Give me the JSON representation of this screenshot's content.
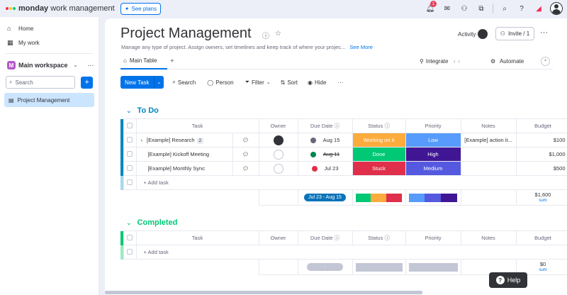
{
  "topbar": {
    "brand": "monday",
    "brand_sub": "work management",
    "see_plans": "See plans",
    "notif_count": "1",
    "logo_colors": [
      "#f62b54",
      "#ffcb00",
      "#00ca72"
    ]
  },
  "sidebar": {
    "items": [
      {
        "label": "Home",
        "icon": "home-icon"
      },
      {
        "label": "My work",
        "icon": "calendar-icon"
      }
    ],
    "workspace": {
      "badge": "M",
      "name": "Main workspace"
    },
    "search_placeholder": "Search",
    "boards": [
      {
        "label": "Project Management",
        "icon": "board-icon"
      }
    ]
  },
  "board": {
    "title": "Project Management",
    "description": "Manage any type of project. Assign owners, set timelines and keep track of where your projec...",
    "see_more": "See More",
    "activity": "Activity",
    "invite": "Invite / 1",
    "tab_main": "Main Table",
    "integrate": "Integrate",
    "automate": "Automate"
  },
  "toolbar": {
    "new_task": "New Task",
    "search": "Search",
    "person": "Person",
    "filter": "Filter",
    "sort": "Sort",
    "hide": "Hide"
  },
  "columns": {
    "task": "Task",
    "owner": "Owner",
    "due_date": "Due Date",
    "status": "Status",
    "priority": "Priority",
    "notes": "Notes",
    "budget": "Budget"
  },
  "groups": [
    {
      "name": "To Do",
      "color": "#0086c0",
      "rows": [
        {
          "task": "[Example] Research",
          "subitems": "2",
          "due": "Aug 15",
          "status": "Working on it",
          "status_color": "#fdab3d",
          "priority": "Low",
          "priority_color": "#579bfc",
          "notes": "[Example] action it...",
          "budget": "$100"
        },
        {
          "task": "[Example] Kickoff Meeting",
          "subitems": "",
          "due": "Aug 11",
          "status": "Done",
          "status_color": "#00c875",
          "priority": "High",
          "priority_color": "#401694",
          "notes": "",
          "budget": "$1,000"
        },
        {
          "task": "[Example] Monthly Sync",
          "subitems": "",
          "due": "Jul 23",
          "status": "Stuck",
          "status_color": "#df2f4a",
          "priority": "Medium",
          "priority_color": "#5559df",
          "notes": "",
          "budget": "$500"
        }
      ],
      "add_task": "+ Add task",
      "timeline": "Jul 23 - Aug 15",
      "status_summary": [
        {
          "color": "#00c875",
          "fraction": 0.333
        },
        {
          "color": "#fdab3d",
          "fraction": 0.333
        },
        {
          "color": "#df2f4a",
          "fraction": 0.334
        }
      ],
      "priority_summary": [
        {
          "color": "#579bfc",
          "fraction": 0.333
        },
        {
          "color": "#5559df",
          "fraction": 0.333
        },
        {
          "color": "#401694",
          "fraction": 0.334
        }
      ],
      "budget_sum": "$1,600",
      "sum_label": "sum"
    },
    {
      "name": "Completed",
      "color": "#00c875",
      "add_task": "+ Add task",
      "timeline": "-",
      "budget_sum": "$0",
      "sum_label": "sum"
    }
  ],
  "help": "Help"
}
